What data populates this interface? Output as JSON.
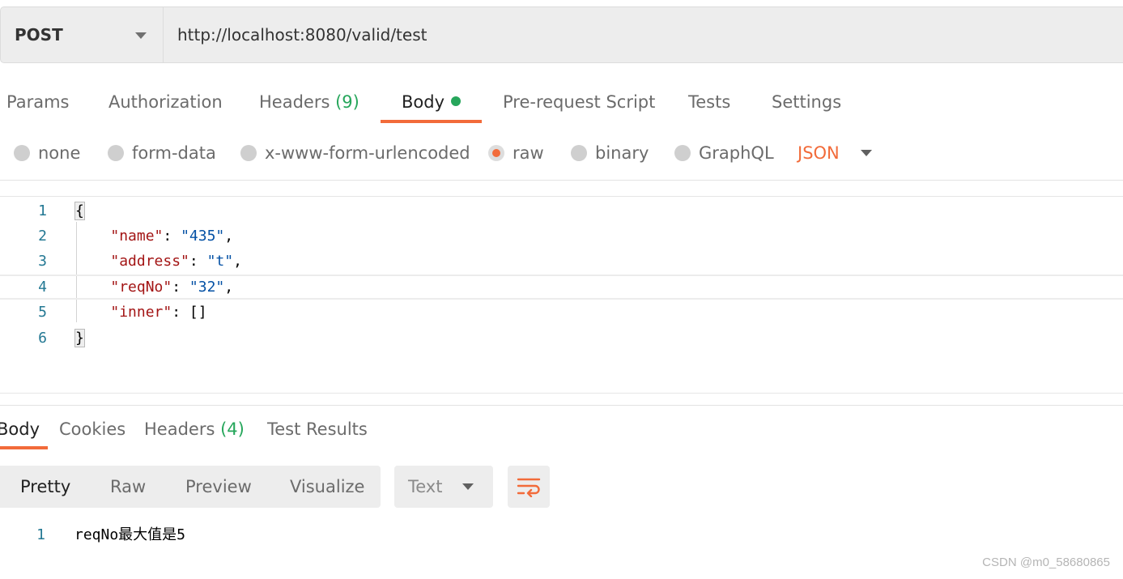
{
  "request": {
    "method": "POST",
    "url": "http://localhost:8080/valid/test"
  },
  "request_tabs": {
    "params": "Params",
    "authorization": "Authorization",
    "headers_label": "Headers",
    "headers_count": "(9)",
    "body": "Body",
    "pre_request_script": "Pre-request Script",
    "tests": "Tests",
    "settings": "Settings",
    "active": "Body"
  },
  "body_types": {
    "none": "none",
    "form_data": "form-data",
    "x_www_form_urlencoded": "x-www-form-urlencoded",
    "raw": "raw",
    "binary": "binary",
    "graphql": "GraphQL",
    "selected": "raw",
    "language": "JSON"
  },
  "editor": {
    "line_numbers": [
      "1",
      "2",
      "3",
      "4",
      "5",
      "6"
    ],
    "open_brace": "{",
    "close_brace": "}",
    "fields": [
      {
        "key": "\"name\"",
        "value": "\"435\"",
        "trail": ","
      },
      {
        "key": "\"address\"",
        "value": "\"t\"",
        "trail": ","
      },
      {
        "key": "\"reqNo\"",
        "value": "\"32\"",
        "trail": ","
      },
      {
        "key": "\"inner\"",
        "value": "[]",
        "trail": ""
      }
    ]
  },
  "response_tabs": {
    "body": "Body",
    "cookies": "Cookies",
    "headers_label": "Headers",
    "headers_count": "(4)",
    "test_results": "Test Results",
    "active": "Body"
  },
  "response_toolbar": {
    "pretty": "Pretty",
    "raw": "Raw",
    "preview": "Preview",
    "visualize": "Visualize",
    "active_view": "Pretty",
    "format": "Text"
  },
  "response_body": {
    "line_number": "1",
    "text": "reqNo最大值是5"
  },
  "watermark": "CSDN @m0_58680865",
  "colors": {
    "accent": "#f26b3a",
    "success": "#26a65b",
    "json_key": "#a31515",
    "json_string": "#0451a5",
    "line_number": "#237893"
  },
  "icons": {
    "method_dropdown": "chevron-down-icon",
    "language_dropdown": "chevron-down-icon",
    "format_dropdown": "chevron-down-icon",
    "wrap_lines": "wrap-lines-icon"
  }
}
